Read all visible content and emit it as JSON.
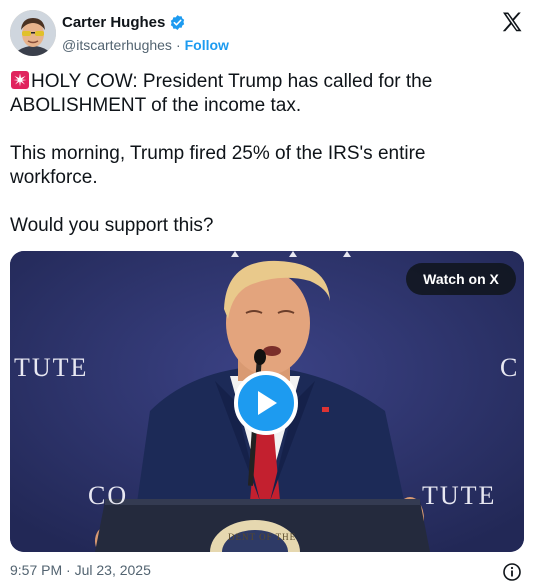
{
  "author": {
    "name": "Carter Hughes",
    "handle": "@itscarterhughes",
    "separator": "·",
    "follow_label": "Follow"
  },
  "tweet": {
    "paragraphs": [
      "HOLY COW: President Trump has called for the ABOLISHMENT of the income tax.",
      "This morning, Trump fired 25% of the IRS's entire workforce.",
      "Would you support this?"
    ],
    "leading_emoji": "siren-icon"
  },
  "media": {
    "watch_label": "Watch on X",
    "wall_left": "TUTE",
    "wall_right": "C",
    "podium_left": "CO",
    "podium_right": "TUTE",
    "seal_text": "DENT OF THE"
  },
  "footer": {
    "timestamp": "9:57 PM · Jul 23, 2025"
  },
  "colors": {
    "accent": "#1d9bf0",
    "text": "#0f1419",
    "muted": "#536471"
  }
}
